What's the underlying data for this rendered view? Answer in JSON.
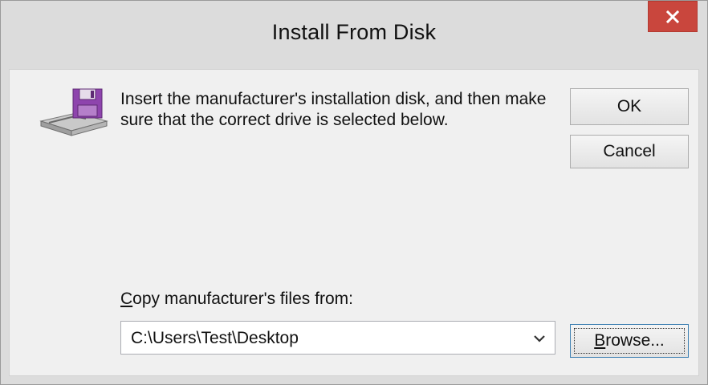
{
  "window": {
    "title": "Install From Disk",
    "close_icon": "close-x-icon"
  },
  "message": "Insert the manufacturer's installation disk, and then make sure that the correct drive is selected below.",
  "buttons": {
    "ok": "OK",
    "cancel": "Cancel",
    "browse_mnemonic": "B",
    "browse_rest": "rowse..."
  },
  "copy_from": {
    "label_mnemonic": "C",
    "label_rest": "opy manufacturer's files from:",
    "value": "C:\\Users\\Test\\Desktop"
  },
  "icons": {
    "disk": "floppy-disk-drive-icon",
    "dropdown": "chevron-down-icon"
  },
  "colors": {
    "close_button": "#c9463d",
    "titlebar": "#dcdcdc",
    "client": "#f0f0f0",
    "focus_border": "#3c7fb1"
  }
}
